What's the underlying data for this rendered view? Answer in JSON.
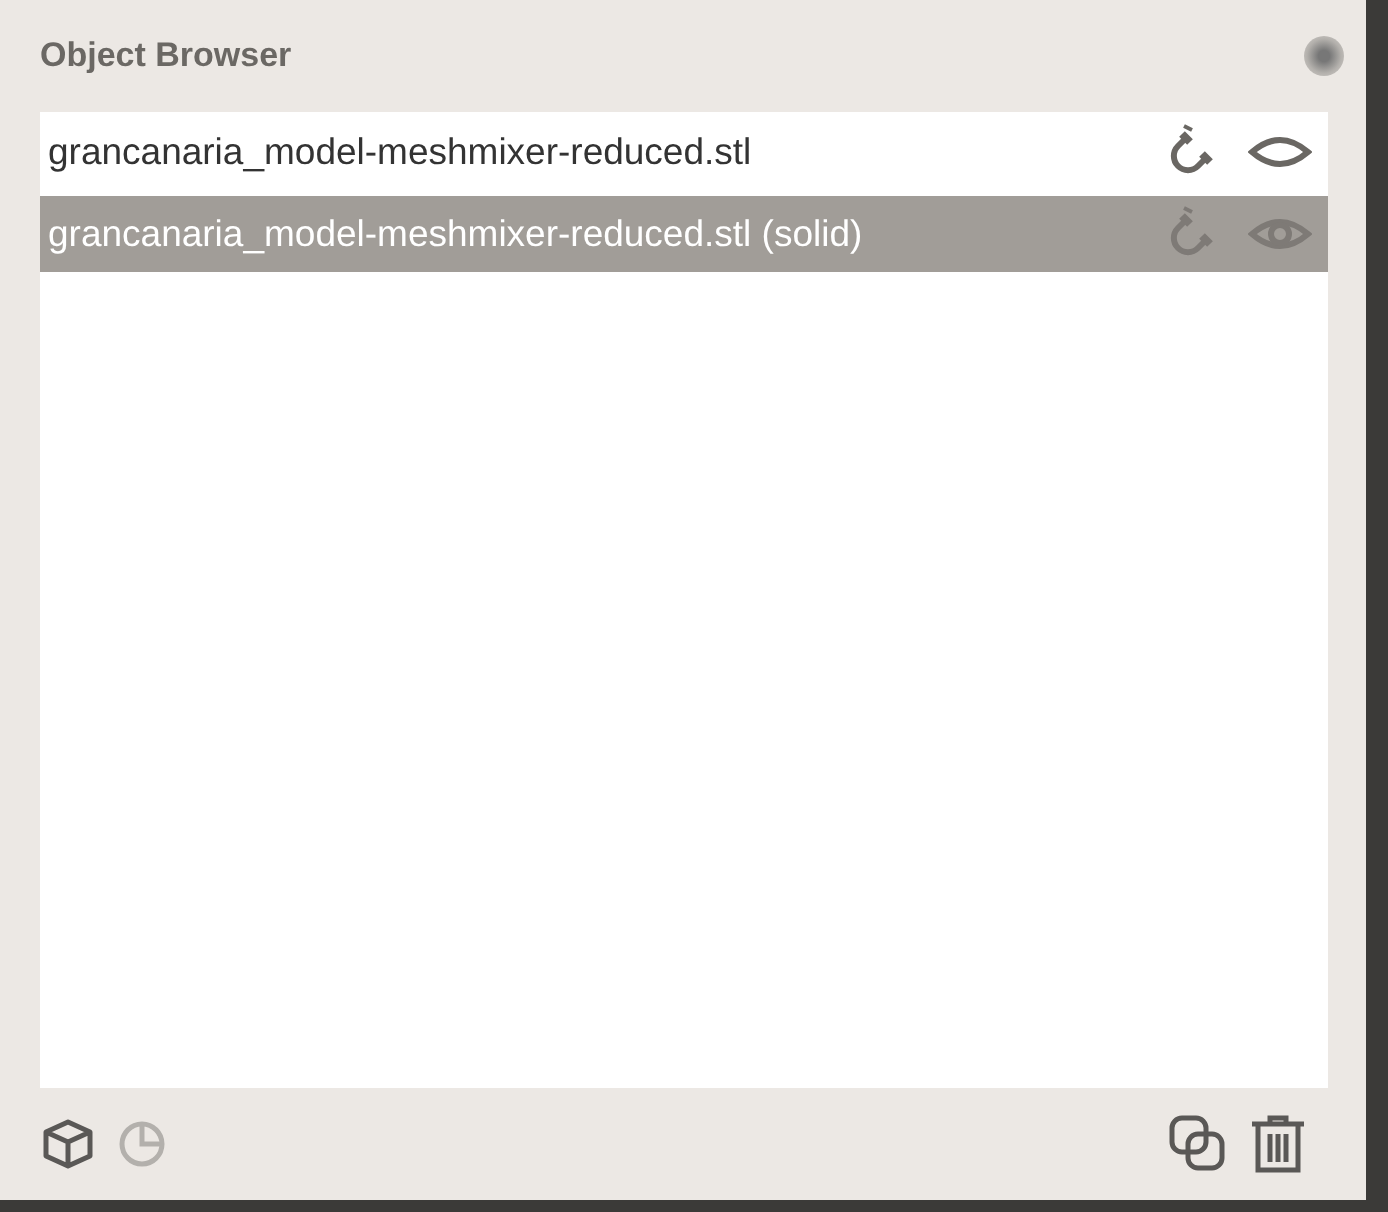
{
  "window": {
    "title": "Object Browser"
  },
  "objects": [
    {
      "name": "grancanaria_model-meshmixer-reduced.stl",
      "selected": false,
      "eye_open": false
    },
    {
      "name": "grancanaria_model-meshmixer-reduced.stl (solid)",
      "selected": true,
      "eye_open": true
    }
  ],
  "toolbar": [
    {
      "kind": "cube",
      "disabled": false
    },
    {
      "kind": "clock",
      "disabled": true
    },
    {
      "kind": "spacer"
    },
    {
      "kind": "duplicate",
      "disabled": false
    },
    {
      "kind": "trash",
      "disabled": false
    }
  ]
}
